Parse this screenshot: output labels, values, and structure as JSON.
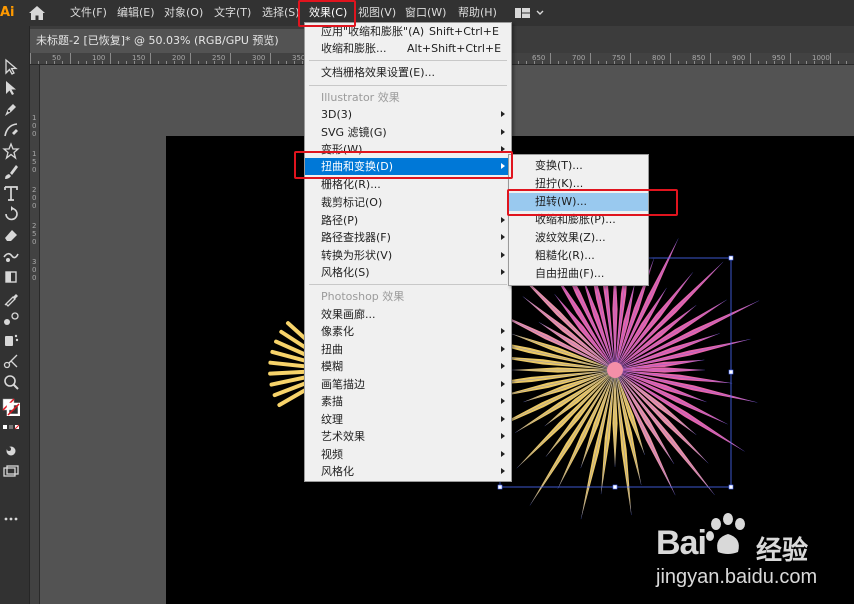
{
  "app": {
    "logo": "Ai"
  },
  "menubar": {
    "items": [
      "文件(F)",
      "编辑(E)",
      "对象(O)",
      "文字(T)",
      "选择(S)",
      "效果(C)",
      "视图(V)",
      "窗口(W)",
      "帮助(H)"
    ],
    "active_index": 5
  },
  "document": {
    "tab_title": "未标题-2 [已恢复]* @ 50.03% (RGB/GPU 预览)",
    "close_glyph": "×"
  },
  "ruler": {
    "top_numbers": [
      "50",
      "100",
      "150",
      "200",
      "250",
      "300",
      "350",
      "400",
      "450",
      "500",
      "550",
      "600",
      "650",
      "700",
      "750",
      "800",
      "850",
      "900",
      "950",
      "1000"
    ],
    "left_numbers": [
      "1",
      "0",
      "0",
      "1",
      "5",
      "0",
      "2",
      "0",
      "0",
      "2",
      "5",
      "0",
      "3",
      "0",
      "0"
    ]
  },
  "effect_menu": {
    "apply_last": {
      "label": "应用\"收缩和膨胀\"(A)",
      "shortcut": "Shift+Ctrl+E"
    },
    "last_effect": {
      "label": "收缩和膨胀...",
      "shortcut": "Alt+Shift+Ctrl+E"
    },
    "doc_raster_settings": "文档栅格效果设置(E)...",
    "illustrator_header": "Illustrator 效果",
    "illustrator_items": [
      "3D(3)",
      "SVG 滤镜(G)",
      "变形(W)",
      "扭曲和变换(D)",
      "栅格化(R)...",
      "裁剪标记(O)",
      "路径(P)",
      "路径查找器(F)",
      "转换为形状(V)",
      "风格化(S)"
    ],
    "photoshop_header": "Photoshop 效果",
    "photoshop_items": [
      "效果画廊...",
      "像素化",
      "扭曲",
      "模糊",
      "画笔描边",
      "素描",
      "纹理",
      "艺术效果",
      "视频",
      "风格化"
    ],
    "highlighted": "扭曲和变换(D)"
  },
  "submenu": {
    "items": [
      "变换(T)...",
      "扭拧(K)...",
      "扭转(W)...",
      "收缩和膨胀(P)...",
      "波纹效果(Z)...",
      "粗糙化(R)...",
      "自由扭曲(F)..."
    ],
    "highlighted": "扭转(W)..."
  },
  "watermark": {
    "brand_left": "Bai",
    "brand_right": "经验",
    "url": "jingyan.baidu.com"
  },
  "colors": {
    "accent_highlight": "#0078d7",
    "submenu_highlight": "#99c9ef",
    "annotation_red": "#e0141e",
    "burst_pink": "#f06ab4",
    "burst_yellow": "#f7d36a"
  }
}
